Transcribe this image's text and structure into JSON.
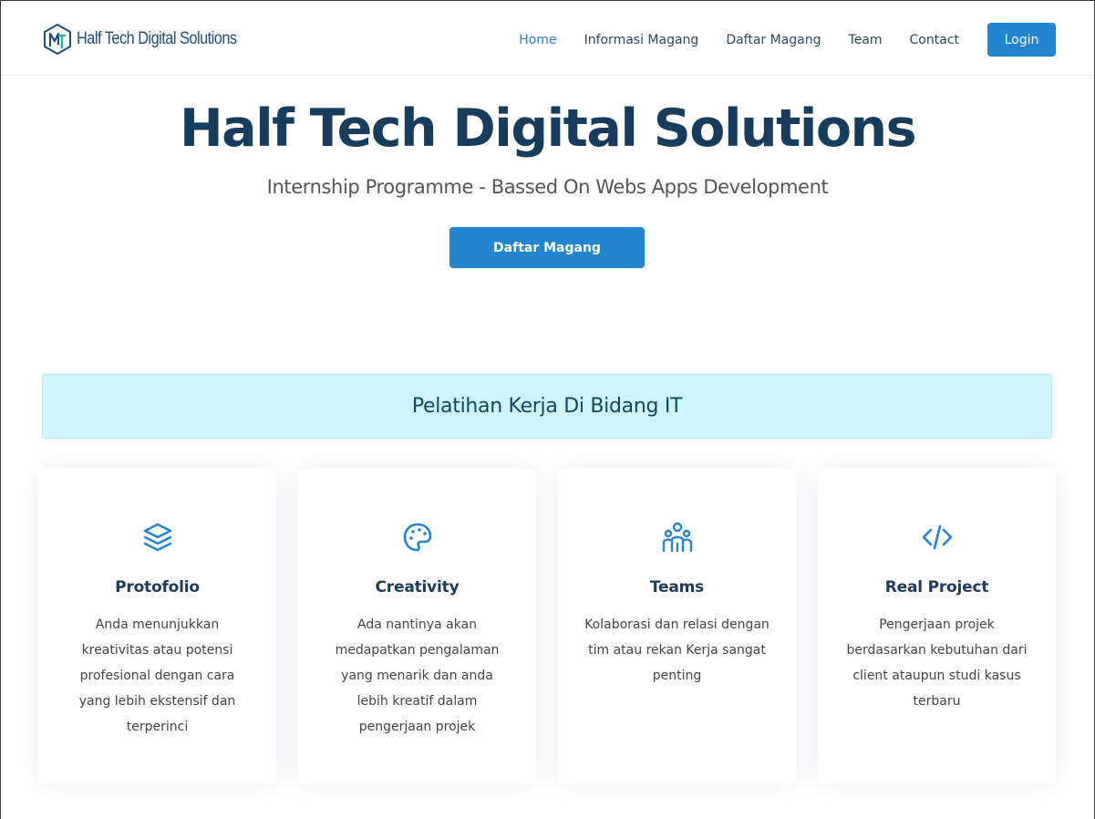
{
  "brand": {
    "name": "Half Tech Digital Solutions",
    "accent": "#2385cf",
    "title_color": "#163c5e"
  },
  "nav": {
    "items": [
      {
        "label": "Home",
        "active": true
      },
      {
        "label": "Informasi Magang",
        "active": false
      },
      {
        "label": "Daftar Magang",
        "active": false
      },
      {
        "label": "Team",
        "active": false
      },
      {
        "label": "Contact",
        "active": false
      }
    ],
    "login_label": "Login"
  },
  "hero": {
    "title": "Half Tech Digital Solutions",
    "subtitle": "Internship Programme - Bassed On Webs Apps Development",
    "cta_label": "Daftar Magang"
  },
  "banner": {
    "text": "Pelatihan Kerja Di Bidang IT",
    "background": "#cef3fb"
  },
  "features": [
    {
      "icon": "layers-icon",
      "title": "Protofolio",
      "description": "Anda menunjukkan kreativitas atau potensi profesional dengan cara yang lebih ekstensif dan terperinci"
    },
    {
      "icon": "palette-icon",
      "title": "Creativity",
      "description": "Ada nantinya akan medapatkan pengalaman yang menarik dan anda lebih kreatif dalam pengerjaan projek"
    },
    {
      "icon": "people-icon",
      "title": "Teams",
      "description": "Kolaborasi dan relasi dengan tim atau rekan Kerja sangat penting"
    },
    {
      "icon": "code-icon",
      "title": "Real Project",
      "description": "Pengerjaan projek berdasarkan kebutuhan dari client ataupun studi kasus terbaru"
    }
  ]
}
